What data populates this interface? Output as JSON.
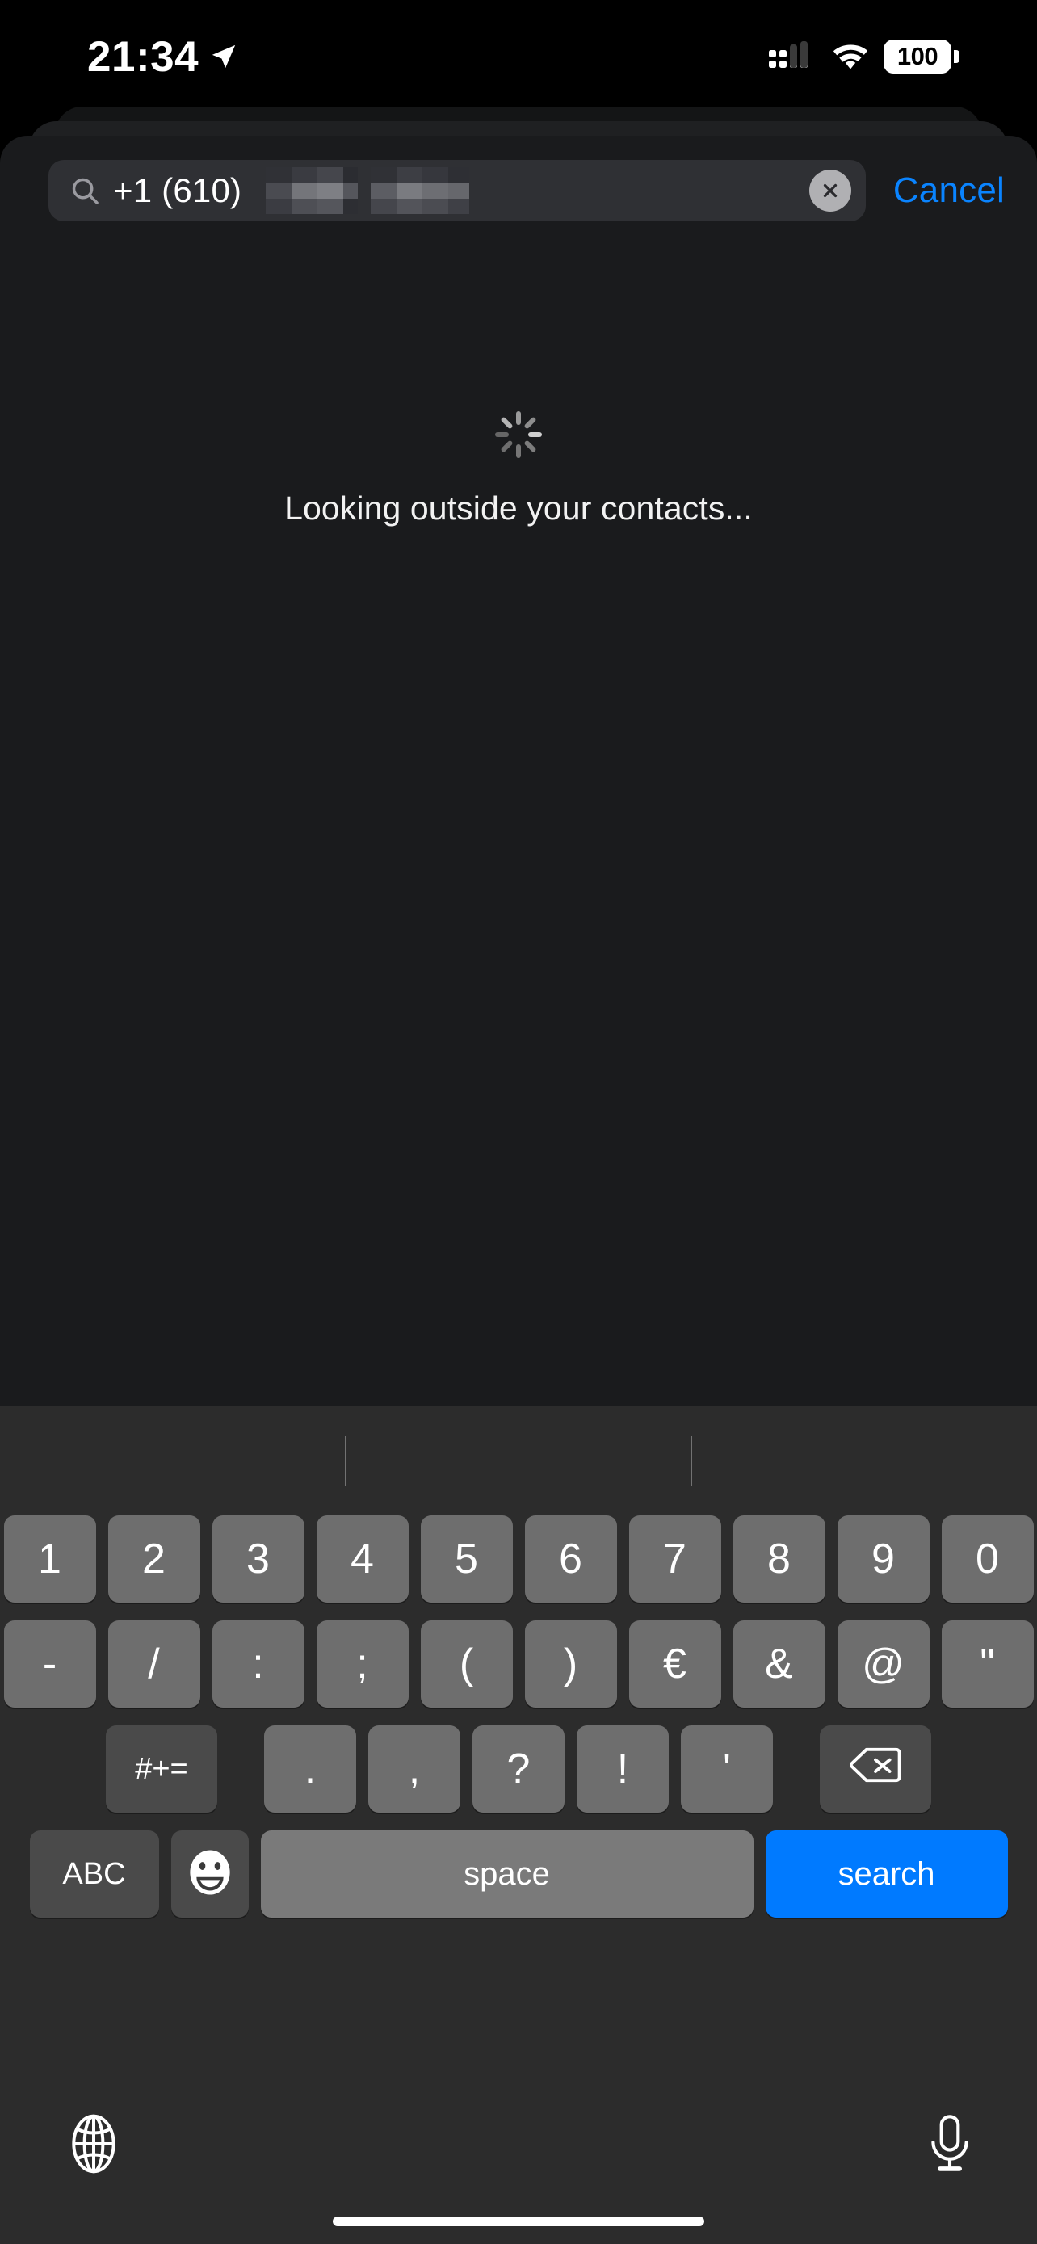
{
  "status_bar": {
    "time": "21:34",
    "location_icon": "location-arrow-icon",
    "cellular_icon": "cellular-signal-icon",
    "wifi_icon": "wifi-icon",
    "battery_percent": "100",
    "battery_icon": "battery-full-icon"
  },
  "search": {
    "magnifier_icon": "search-icon",
    "value": "+1 (610)",
    "redacted_note": "redacted-phone-digits",
    "clear_icon": "clear-circle-icon",
    "cancel_label": "Cancel",
    "cancel_color": "#0a84ff"
  },
  "content": {
    "spinner_icon": "activity-spinner-icon",
    "status_text": "Looking outside your contacts..."
  },
  "keyboard": {
    "predictive_bar": {
      "suggestions": [
        "",
        "",
        ""
      ]
    },
    "row1": [
      "1",
      "2",
      "3",
      "4",
      "5",
      "6",
      "7",
      "8",
      "9",
      "0"
    ],
    "row2": [
      "-",
      "/",
      ":",
      ";",
      "(",
      ")",
      "€",
      "&",
      "@",
      "\""
    ],
    "row3_symbols_key": "#+=",
    "row3": [
      ".",
      ",",
      "?",
      "!",
      "'"
    ],
    "row3_backspace_icon": "backspace-icon",
    "abc_label": "ABC",
    "emoji_icon": "emoji-smiley-icon",
    "space_label": "space",
    "search_label": "search",
    "search_key_color": "#007aff",
    "globe_icon": "globe-icon",
    "mic_icon": "microphone-icon"
  },
  "home_indicator": "home-indicator"
}
